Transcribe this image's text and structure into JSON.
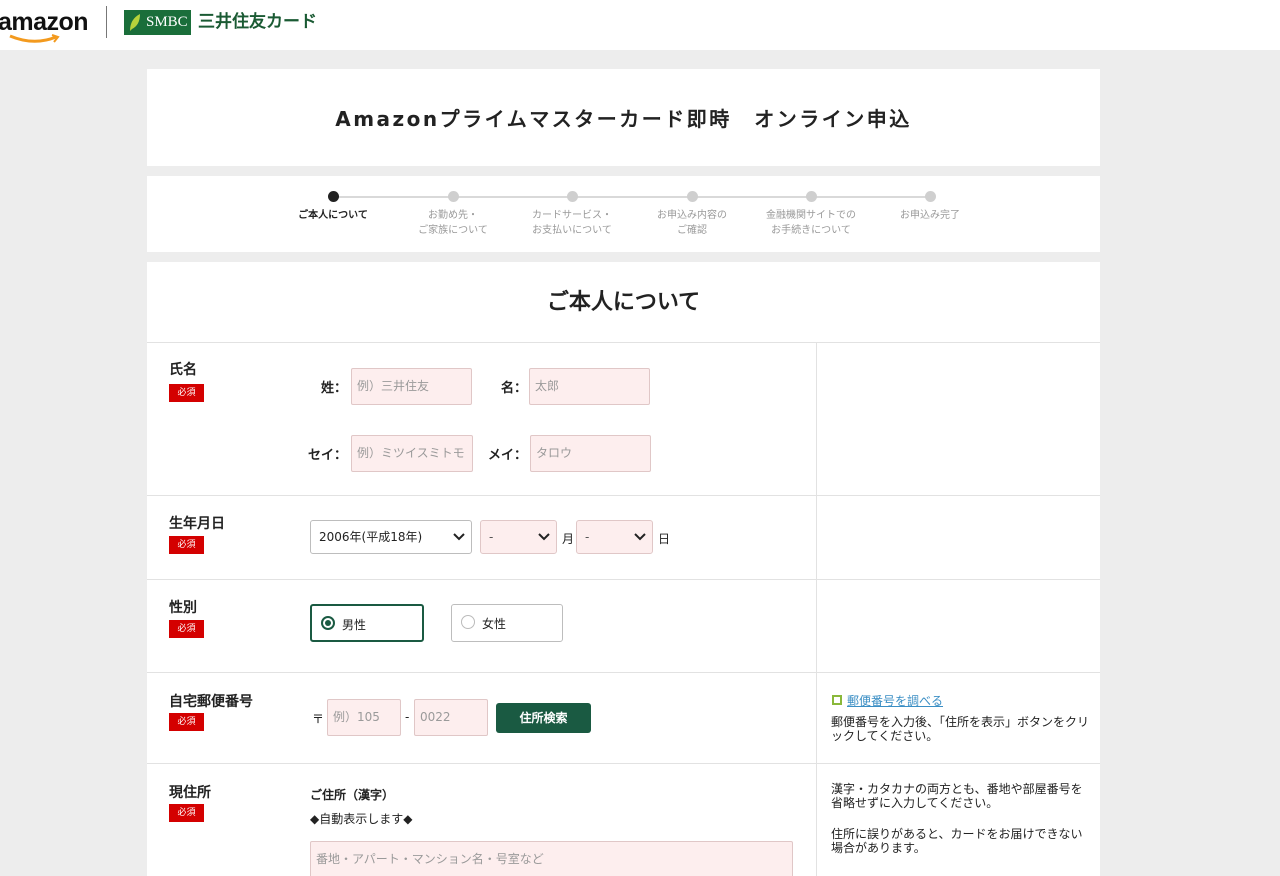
{
  "header": {
    "amazon_logo": "amazon",
    "smbc_logo": "SMBC",
    "smbc_card_name": "三井住友カード"
  },
  "page_title": "Amazonプライムマスターカード即時　オンライン申込",
  "steps": [
    {
      "label": "ご本人について",
      "active": true
    },
    {
      "label": "お勤め先・\nご家族について",
      "active": false
    },
    {
      "label": "カードサービス・\nお支払いについて",
      "active": false
    },
    {
      "label": "お申込み内容の\nご確認",
      "active": false
    },
    {
      "label": "金融機関サイトでの\nお手続きについて",
      "active": false
    },
    {
      "label": "お申込み完了",
      "active": false
    }
  ],
  "section_title": "ご本人について",
  "required_badge": "必須",
  "name": {
    "label": "氏名",
    "sei_label": "姓：",
    "sei_placeholder": "例）三井住友",
    "mei_label": "名：",
    "mei_placeholder": "太郎",
    "sei_kana_label": "セイ：",
    "sei_kana_placeholder": "例）ミツイスミトモ",
    "mei_kana_label": "メイ：",
    "mei_kana_placeholder": "タロウ"
  },
  "birthdate": {
    "label": "生年月日",
    "year_value": "2006年(平成18年)",
    "month_value": "-",
    "month_unit": "月",
    "day_value": "-",
    "day_unit": "日"
  },
  "gender": {
    "label": "性別",
    "male": "男性",
    "female": "女性",
    "selected": "男性"
  },
  "postal": {
    "label": "自宅郵便番号",
    "prefix": "〒",
    "first_placeholder": "例）105",
    "dash": "-",
    "second_placeholder": "0022",
    "search_button": "住所検索",
    "lookup_link": "郵便番号を調べる",
    "note": "郵便番号を入力後、「住所を表示」ボタンをクリックしてください。"
  },
  "address": {
    "label": "現住所",
    "kanji_label": "ご住所（漢字）",
    "auto_note": "◆自動表示します◆",
    "line_placeholder": "番地・アパート・マンション名・号室など",
    "note1": "漢字・カタカナの両方とも、番地や部屋番号を省略せずに入力してください。",
    "note2": "住所に誤りがあると、カードをお届けできない場合があります。"
  },
  "colors": {
    "brand_green": "#1a5a42",
    "required_red": "#d40000",
    "input_pink": "#fdeeee",
    "link_blue": "#3a8ec4"
  }
}
